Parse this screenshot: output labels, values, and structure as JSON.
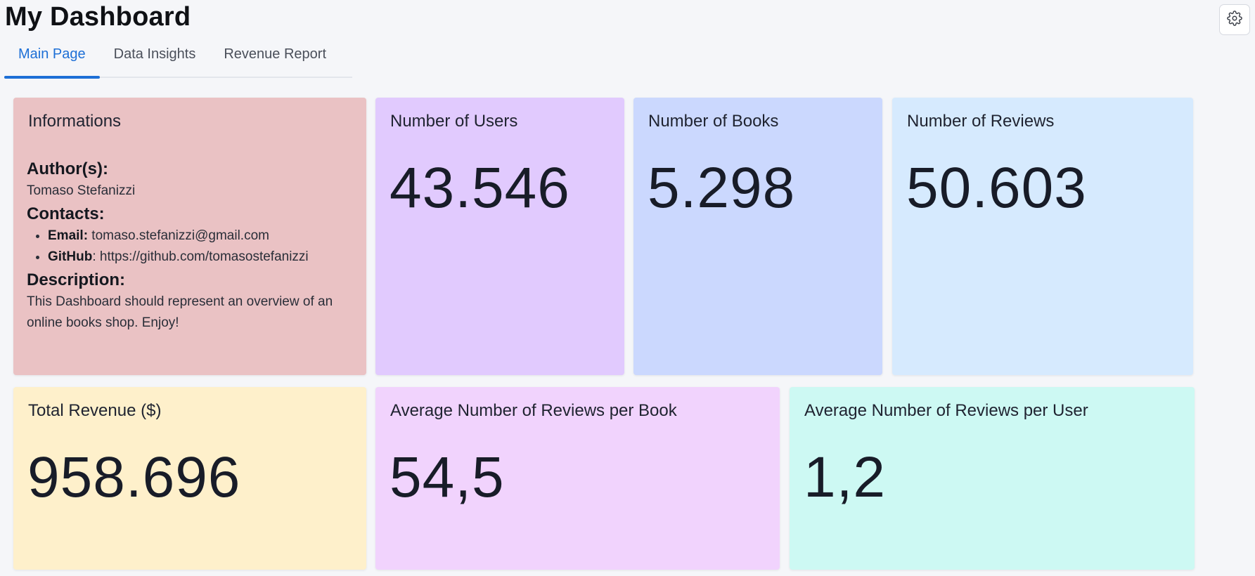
{
  "header": {
    "title": "My Dashboard",
    "settings_icon": "gear-icon"
  },
  "tabs": [
    {
      "label": "Main Page",
      "active": true
    },
    {
      "label": "Data Insights",
      "active": false
    },
    {
      "label": "Revenue Report",
      "active": false
    }
  ],
  "colors": {
    "accent": "#1d6fd6",
    "info_card": "#eac2c4",
    "users_card": "#e1cafe",
    "books_card": "#cbd8fe",
    "reviews_card": "#d6eafe",
    "revenue_card": "#fef0cb",
    "avg_book_card": "#f1d3fd",
    "avg_user_card": "#cdf9f3"
  },
  "info": {
    "title": "Informations",
    "author_heading": "Author(s):",
    "author_name": "Tomaso Stefanizzi",
    "contacts_heading": "Contacts:",
    "email_label": "Email:",
    "email_value": " tomaso.stefanizzi@gmail.com",
    "github_label": "GitHub",
    "github_value": ": https://github.com/tomasostefanizzi",
    "description_heading": "Description:",
    "description_text": "This Dashboard should represent an overview of an online books shop. Enjoy!"
  },
  "metrics": {
    "users": {
      "title": "Number of Users",
      "value": "43.546"
    },
    "books": {
      "title": "Number of Books",
      "value": "5.298"
    },
    "reviews": {
      "title": "Number of Reviews",
      "value": "50.603"
    },
    "revenue": {
      "title": "Total Revenue ($)",
      "value": "958.696"
    },
    "avg_reviews_book": {
      "title": "Average Number of Reviews per Book",
      "value": "54,5"
    },
    "avg_reviews_user": {
      "title": "Average Number of Reviews per User",
      "value": "1,2"
    }
  }
}
